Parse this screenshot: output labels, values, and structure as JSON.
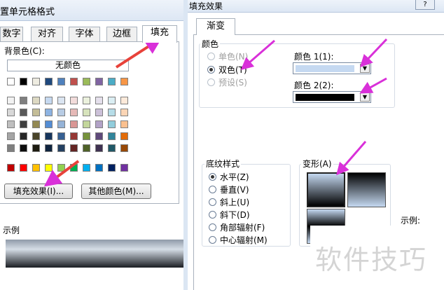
{
  "left_dialog": {
    "title": "置单元格格式",
    "tabs": [
      {
        "label": "数字"
      },
      {
        "label": "对齐"
      },
      {
        "label": "字体"
      },
      {
        "label": "边框"
      },
      {
        "label": "填充",
        "active": true
      }
    ],
    "background_color_label": "背景色(C):",
    "no_color_label": "无颜色",
    "fill_effects_button": "填充效果(I)...",
    "more_colors_button": "其他颜色(M)...",
    "sample_label": "示例"
  },
  "right_dialog": {
    "title": "填充效果",
    "help_button": "?",
    "tab": "渐变",
    "colors_group": "颜色",
    "color_options": [
      {
        "label": "单色(N)",
        "selected": false,
        "disabled": true
      },
      {
        "label": "双色(T)",
        "selected": true,
        "disabled": false
      },
      {
        "label": "预设(S)",
        "selected": false,
        "disabled": true
      }
    ],
    "color1_label": "颜色 1(1):",
    "color1_value": "#c5d9f1",
    "color2_label": "颜色 2(2):",
    "color2_value": "#000000",
    "shading_group": "底纹样式",
    "shading_styles": [
      {
        "label": "水平(Z)",
        "selected": true
      },
      {
        "label": "垂直(V)",
        "selected": false
      },
      {
        "label": "斜上(U)",
        "selected": false
      },
      {
        "label": "斜下(D)",
        "selected": false
      },
      {
        "label": "角部辐射(F)",
        "selected": false
      },
      {
        "label": "中心辐射(M)",
        "selected": false
      }
    ],
    "variants_label": "变形(A)",
    "sample_label": "示例:"
  },
  "watermark": "软件技巧",
  "colors": {
    "arrow_red": "#e8423a",
    "arrow_magenta": "#d930d9",
    "gradient_light": "#c5d9f1",
    "gradient_dark": "#000000"
  },
  "palette": {
    "row0": [
      "#ffffff",
      "#000000",
      "#eeece1",
      "#1f497d",
      "#4f81bd",
      "#c0504d",
      "#9bbb59",
      "#8064a2",
      "#4bacc6",
      "#f79646"
    ],
    "theme_rows": [
      [
        "#f2f2f2",
        "#7f7f7f",
        "#ddd9c3",
        "#c6d9f0",
        "#dbe5f1",
        "#f2dcdb",
        "#ebf1dd",
        "#e5e0ec",
        "#dbeef3",
        "#fdeada"
      ],
      [
        "#d8d8d8",
        "#595959",
        "#c4bd97",
        "#8db3e2",
        "#b8cce4",
        "#e5b9b7",
        "#d7e3bc",
        "#ccc1d9",
        "#b7dde8",
        "#fbd5b5"
      ],
      [
        "#bfbfbf",
        "#3f3f3f",
        "#938953",
        "#548dd4",
        "#95b3d7",
        "#d99694",
        "#c3d69b",
        "#b2a2c7",
        "#92cddc",
        "#fac08f"
      ],
      [
        "#a5a5a5",
        "#262626",
        "#494429",
        "#17365d",
        "#366092",
        "#953734",
        "#76923c",
        "#5f497a",
        "#31859b",
        "#e36c09"
      ],
      [
        "#7f7f7f",
        "#0c0c0c",
        "#1d1b10",
        "#0f243e",
        "#244061",
        "#632423",
        "#4f6128",
        "#3f3151",
        "#205867",
        "#974806"
      ]
    ],
    "standard": [
      "#c00000",
      "#ff0000",
      "#ffc000",
      "#ffff00",
      "#92d050",
      "#00b050",
      "#00b0f0",
      "#0070c0",
      "#002060",
      "#7030a0"
    ]
  }
}
